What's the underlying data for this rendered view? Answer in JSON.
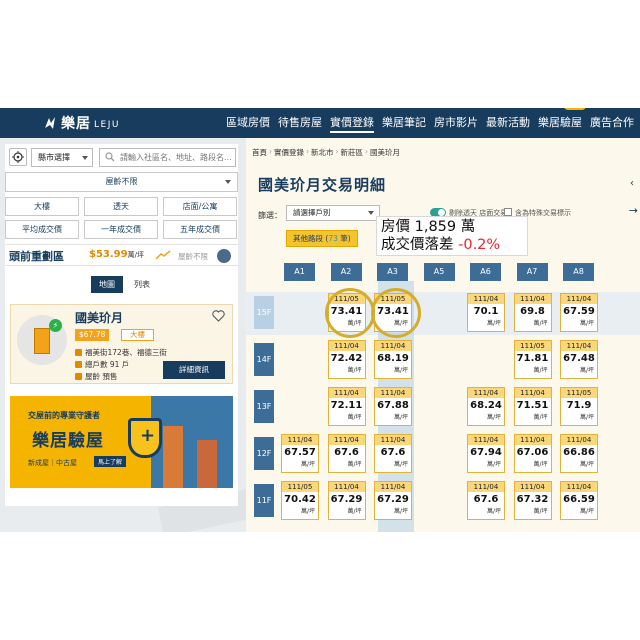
{
  "nav": {
    "logo_cn": "樂居",
    "logo_en": "LEJU",
    "items": [
      "區域房價",
      "待售房屋",
      "實價登錄",
      "樂居筆記",
      "房市影片",
      "最新活動",
      "樂居驗屋",
      "廣告合作"
    ],
    "active": "實價登錄",
    "new_badge": "NEW"
  },
  "sidebar": {
    "city_select": "縣市選擇",
    "search_placeholder": "請輸入社區名、地址、路段名...",
    "age_select": "屋齡不限",
    "filters": [
      "大樓",
      "透天",
      "店面/公寓",
      "平均成交價",
      "一年成交價",
      "五年成交價"
    ],
    "hot_title": "頭前重劃區",
    "hot_price": "$53.99",
    "hot_unit": "萬/坪",
    "hot_age": "屋齡不限",
    "view_tabs": [
      "地圖",
      "列表"
    ],
    "active_tab": "地圖",
    "card": {
      "name": "國美玠月",
      "price_tag": "$67.78",
      "type_tag": "大樓",
      "address": "福美街172巷、福德三街",
      "households": "總戶數 91 戶",
      "age": "屋齡 預售",
      "detail_button": "詳細資訊"
    },
    "banner": {
      "subtitle": "交屋前的專業守護者",
      "title": "樂居驗屋",
      "footer": "新成屋｜中古屋",
      "cta": "馬上了解"
    }
  },
  "main": {
    "breadcrumb": [
      "首頁",
      "實價登錄",
      "新北市",
      "新莊區",
      "國美玠月"
    ],
    "title": "國美玠月交易明細",
    "filter_label": "篩選：",
    "unit_select": "請選擇戶別",
    "toggle_label": "剔除透天 店面交易",
    "checkbox_label": "含為特殊交易標示",
    "floor_button_prefix": "其他路段 (",
    "floor_button_count": "73",
    "floor_button_suffix": " 筆)",
    "overlay_line1": "房價 1,859 萬",
    "overlay_line2_prefix": "成交價落差 ",
    "overlay_line2_value": "-0.2%",
    "columns": [
      "A1",
      "A2",
      "A3",
      "A5",
      "A6",
      "A7",
      "A8"
    ],
    "unit_label": "萬/坪",
    "rows": [
      {
        "floor": "15F",
        "cells": [
          null,
          {
            "date": "111/05",
            "price": "73.41"
          },
          {
            "date": "111/05",
            "price": "73.41"
          },
          null,
          {
            "date": "111/04",
            "price": "70.1"
          },
          {
            "date": "111/04",
            "price": "69.8"
          },
          {
            "date": "111/04",
            "price": "67.59"
          }
        ]
      },
      {
        "floor": "14F",
        "cells": [
          null,
          {
            "date": "111/04",
            "price": "72.42"
          },
          {
            "date": "111/04",
            "price": "68.19"
          },
          null,
          null,
          {
            "date": "111/05",
            "price": "71.81"
          },
          {
            "date": "111/04",
            "price": "67.48"
          }
        ]
      },
      {
        "floor": "13F",
        "cells": [
          null,
          {
            "date": "111/04",
            "price": "72.11"
          },
          {
            "date": "111/04",
            "price": "67.88"
          },
          null,
          {
            "date": "111/04",
            "price": "68.24"
          },
          {
            "date": "111/04",
            "price": "71.51"
          },
          {
            "date": "111/05",
            "price": "71.9"
          }
        ]
      },
      {
        "floor": "12F",
        "cells": [
          {
            "date": "111/04",
            "price": "67.57"
          },
          {
            "date": "111/04",
            "price": "67.6"
          },
          {
            "date": "111/04",
            "price": "67.6"
          },
          null,
          {
            "date": "111/04",
            "price": "67.94"
          },
          {
            "date": "111/04",
            "price": "67.06"
          },
          {
            "date": "111/04",
            "price": "66.86"
          }
        ]
      },
      {
        "floor": "11F",
        "cells": [
          {
            "date": "111/05",
            "price": "70.42"
          },
          {
            "date": "111/04",
            "price": "67.29"
          },
          {
            "date": "111/04",
            "price": "67.29"
          },
          null,
          {
            "date": "111/04",
            "price": "67.6"
          },
          {
            "date": "111/04",
            "price": "67.32"
          },
          {
            "date": "111/04",
            "price": "66.59"
          }
        ]
      }
    ]
  }
}
